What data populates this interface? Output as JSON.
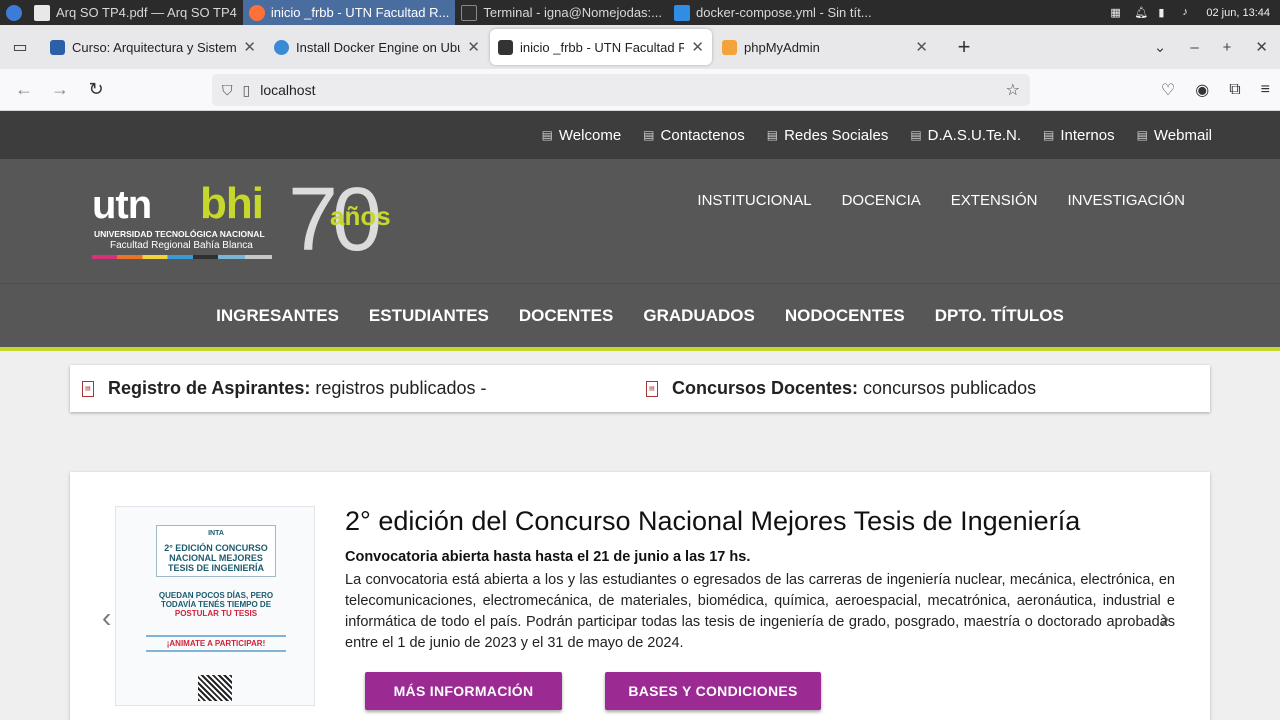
{
  "taskbar": {
    "items": [
      {
        "label": "Arq SO TP4.pdf — Arq SO TP4",
        "color": "#e8e8e8"
      },
      {
        "label": "inicio _frbb - UTN Facultad R...",
        "color": "#ff7139"
      },
      {
        "label": "Terminal - igna@Nomejodas:...",
        "color": "#2f2f2f"
      },
      {
        "label": "docker-compose.yml - Sin tít...",
        "color": "#2f8de4"
      }
    ],
    "clock": "02 jun, 13:44"
  },
  "tabs": [
    {
      "title": "Curso: Arquitectura y Sistema",
      "favicon_color": "#2d5fa8"
    },
    {
      "title": "Install Docker Engine on Ubun",
      "favicon_color": "#3a8ad6"
    },
    {
      "title": "inicio _frbb - UTN Facultad Re",
      "favicon_color": "#333333"
    },
    {
      "title": "phpMyAdmin",
      "favicon_color": "#f2a43a"
    }
  ],
  "url": "localhost",
  "topbar": [
    "Welcome",
    "Contactenos",
    "Redes Sociales",
    "D.A.S.U.Te.N.",
    "Internos",
    "Webmail"
  ],
  "logo": {
    "utn": "utn",
    "bhi": "bhi",
    "line1": "UNIVERSIDAD TECNOLÓGICA NACIONAL",
    "line2": "Facultad Regional Bahía Blanca",
    "seventy": "70",
    "anos": "años"
  },
  "hero_links": [
    "INSTITUCIONAL",
    "DOCENCIA",
    "EXTENSIÓN",
    "INVESTIGACIÓN"
  ],
  "main_nav": [
    "INGRESANTES",
    "ESTUDIANTES",
    "DOCENTES",
    "GRADUADOS",
    "NODOCENTES",
    "DPTO. TÍTULOS"
  ],
  "notices": [
    {
      "bold": "Registro de Aspirantes:",
      "text": " registros publicados -"
    },
    {
      "bold": "Concursos Docentes:",
      "text": " concursos publicados"
    }
  ],
  "feature": {
    "title": "2° edición del Concurso Nacional Mejores Tesis de Ingeniería",
    "deadline": "Convocatoria abierta hasta hasta el 21 de junio a las 17 hs.",
    "description": "La convocatoria está abierta a los y las estudiantes o egresados de las carreras de ingeniería nuclear, mecánica, electrónica, en telecomunicaciones, electromecánica, de materiales, biomédica, química, aeroespacial, mecatrónica, aeronáutica, industrial e informática de todo el país. Podrán participar todas las tesis de ingeniería de grado, posgrado, maestría o doctorado aprobadas entre el 1 de junio de 2023 y el 31 de mayo de 2024.",
    "btn_more": "MÁS INFORMACIÓN",
    "btn_rules": "BASES Y CONDICIONES",
    "poster": {
      "inta": "INTA",
      "title": "2° EDICIÓN CONCURSO NACIONAL MEJORES TESIS DE INGENIERÍA",
      "mid1": "QUEDAN POCOS DÍAS, PERO",
      "mid2": "TODAVÍA TENÉS TIEMPO DE",
      "mid3": "POSTULAR TU TESIS",
      "cta": "¡ANIMATE A PARTICIPAR!"
    }
  },
  "colors": {
    "accent": "#c6d82c",
    "button": "#9b2a93",
    "header": "#575757",
    "topbar": "#3d3d3d"
  }
}
